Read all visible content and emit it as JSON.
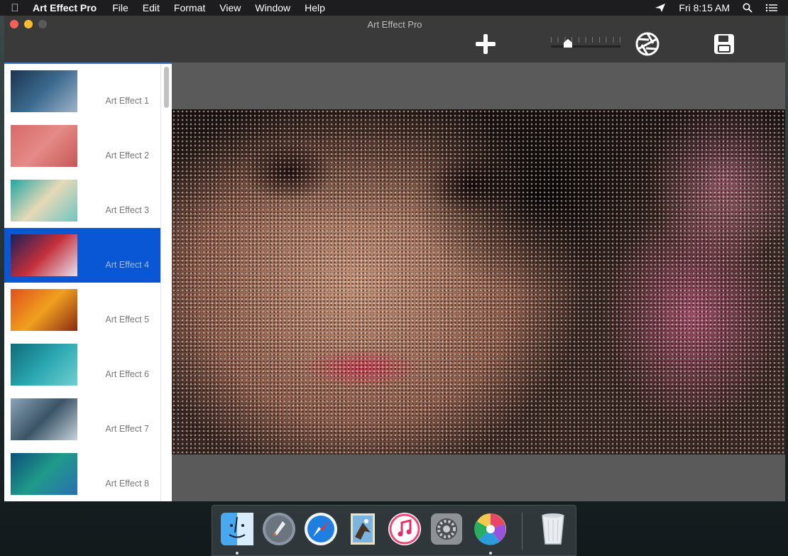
{
  "menubar": {
    "app_name": "Art Effect Pro",
    "menus": [
      "File",
      "Edit",
      "Format",
      "View",
      "Window",
      "Help"
    ],
    "clock": "Fri 8:15 AM"
  },
  "window": {
    "title": "Art Effect Pro",
    "zoom_level": 0.2
  },
  "sidebar": {
    "selected_index": 3,
    "items": [
      {
        "label": "Art Effect 1",
        "colors": [
          "#1b3550",
          "#3b6a8e",
          "#9fb3c9"
        ]
      },
      {
        "label": "Art Effect 2",
        "colors": [
          "#d86a6a",
          "#e58a86",
          "#c45858"
        ]
      },
      {
        "label": "Art Effect 3",
        "colors": [
          "#1fa7a4",
          "#e7d9b8",
          "#6ec5c0"
        ]
      },
      {
        "label": "Art Effect 4",
        "colors": [
          "#1b1f5a",
          "#c4303a",
          "#e8e0f0"
        ]
      },
      {
        "label": "Art Effect 5",
        "colors": [
          "#e0501c",
          "#f0a020",
          "#8a2a10"
        ]
      },
      {
        "label": "Art Effect 6",
        "colors": [
          "#0f6b78",
          "#2aa6b0",
          "#6fd0d0"
        ]
      },
      {
        "label": "Art Effect 7",
        "colors": [
          "#8aa3b8",
          "#3a5466",
          "#c7d3dc"
        ]
      },
      {
        "label": "Art Effect 8",
        "colors": [
          "#0f4f7a",
          "#1f9a8a",
          "#2b6fb0"
        ]
      }
    ]
  },
  "dock": {
    "apps": [
      {
        "name": "finder-icon",
        "running": true
      },
      {
        "name": "launchpad-icon",
        "running": false
      },
      {
        "name": "safari-icon",
        "running": false
      },
      {
        "name": "mail-icon",
        "running": false
      },
      {
        "name": "itunes-icon",
        "running": false
      },
      {
        "name": "system-preferences-icon",
        "running": false
      },
      {
        "name": "art-effect-pro-icon",
        "running": true
      }
    ]
  }
}
